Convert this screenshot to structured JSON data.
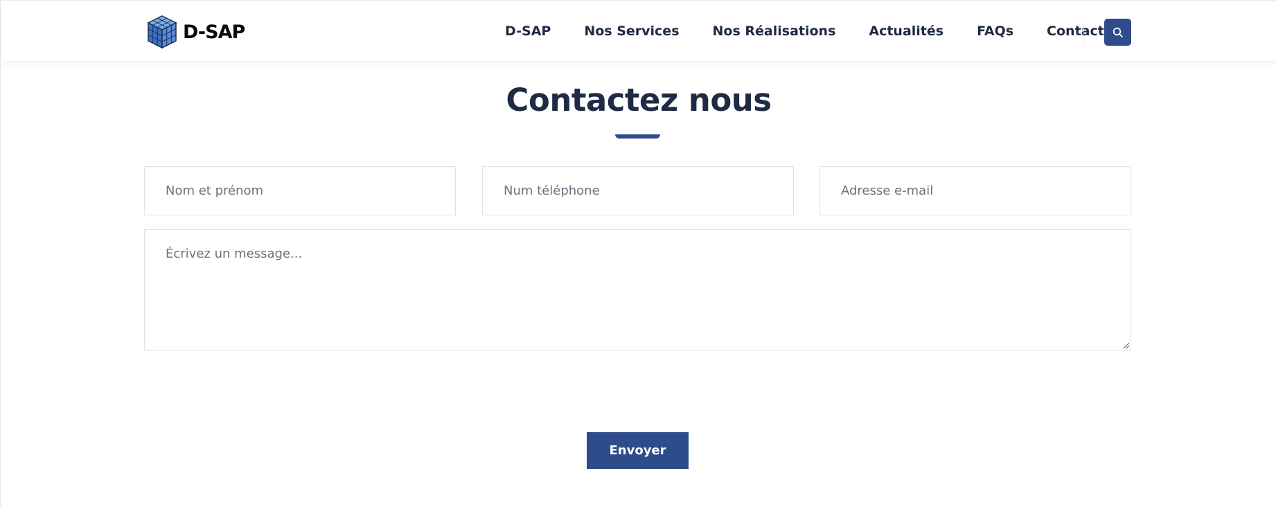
{
  "brand": {
    "name": "D-SAP",
    "logo_icon": "rubik-cube-icon"
  },
  "nav": {
    "items": [
      {
        "label": "D-SAP"
      },
      {
        "label": "Nos Services"
      },
      {
        "label": "Nos Réalisations"
      },
      {
        "label": "Actualités"
      },
      {
        "label": "FAQs"
      },
      {
        "label": "Contact"
      }
    ],
    "search_icon": "search-icon"
  },
  "section": {
    "title": "Contactez nous"
  },
  "form": {
    "name_placeholder": "Nom et prénom",
    "phone_placeholder": "Num téléphone",
    "email_placeholder": "Adresse e-mail",
    "message_placeholder": "Écrivez un message...",
    "submit_label": "Envoyer"
  },
  "colors": {
    "accent": "#2e4b8b",
    "text": "#1f2a44",
    "placeholder": "#6b7280",
    "border": "#dfe1e6"
  }
}
